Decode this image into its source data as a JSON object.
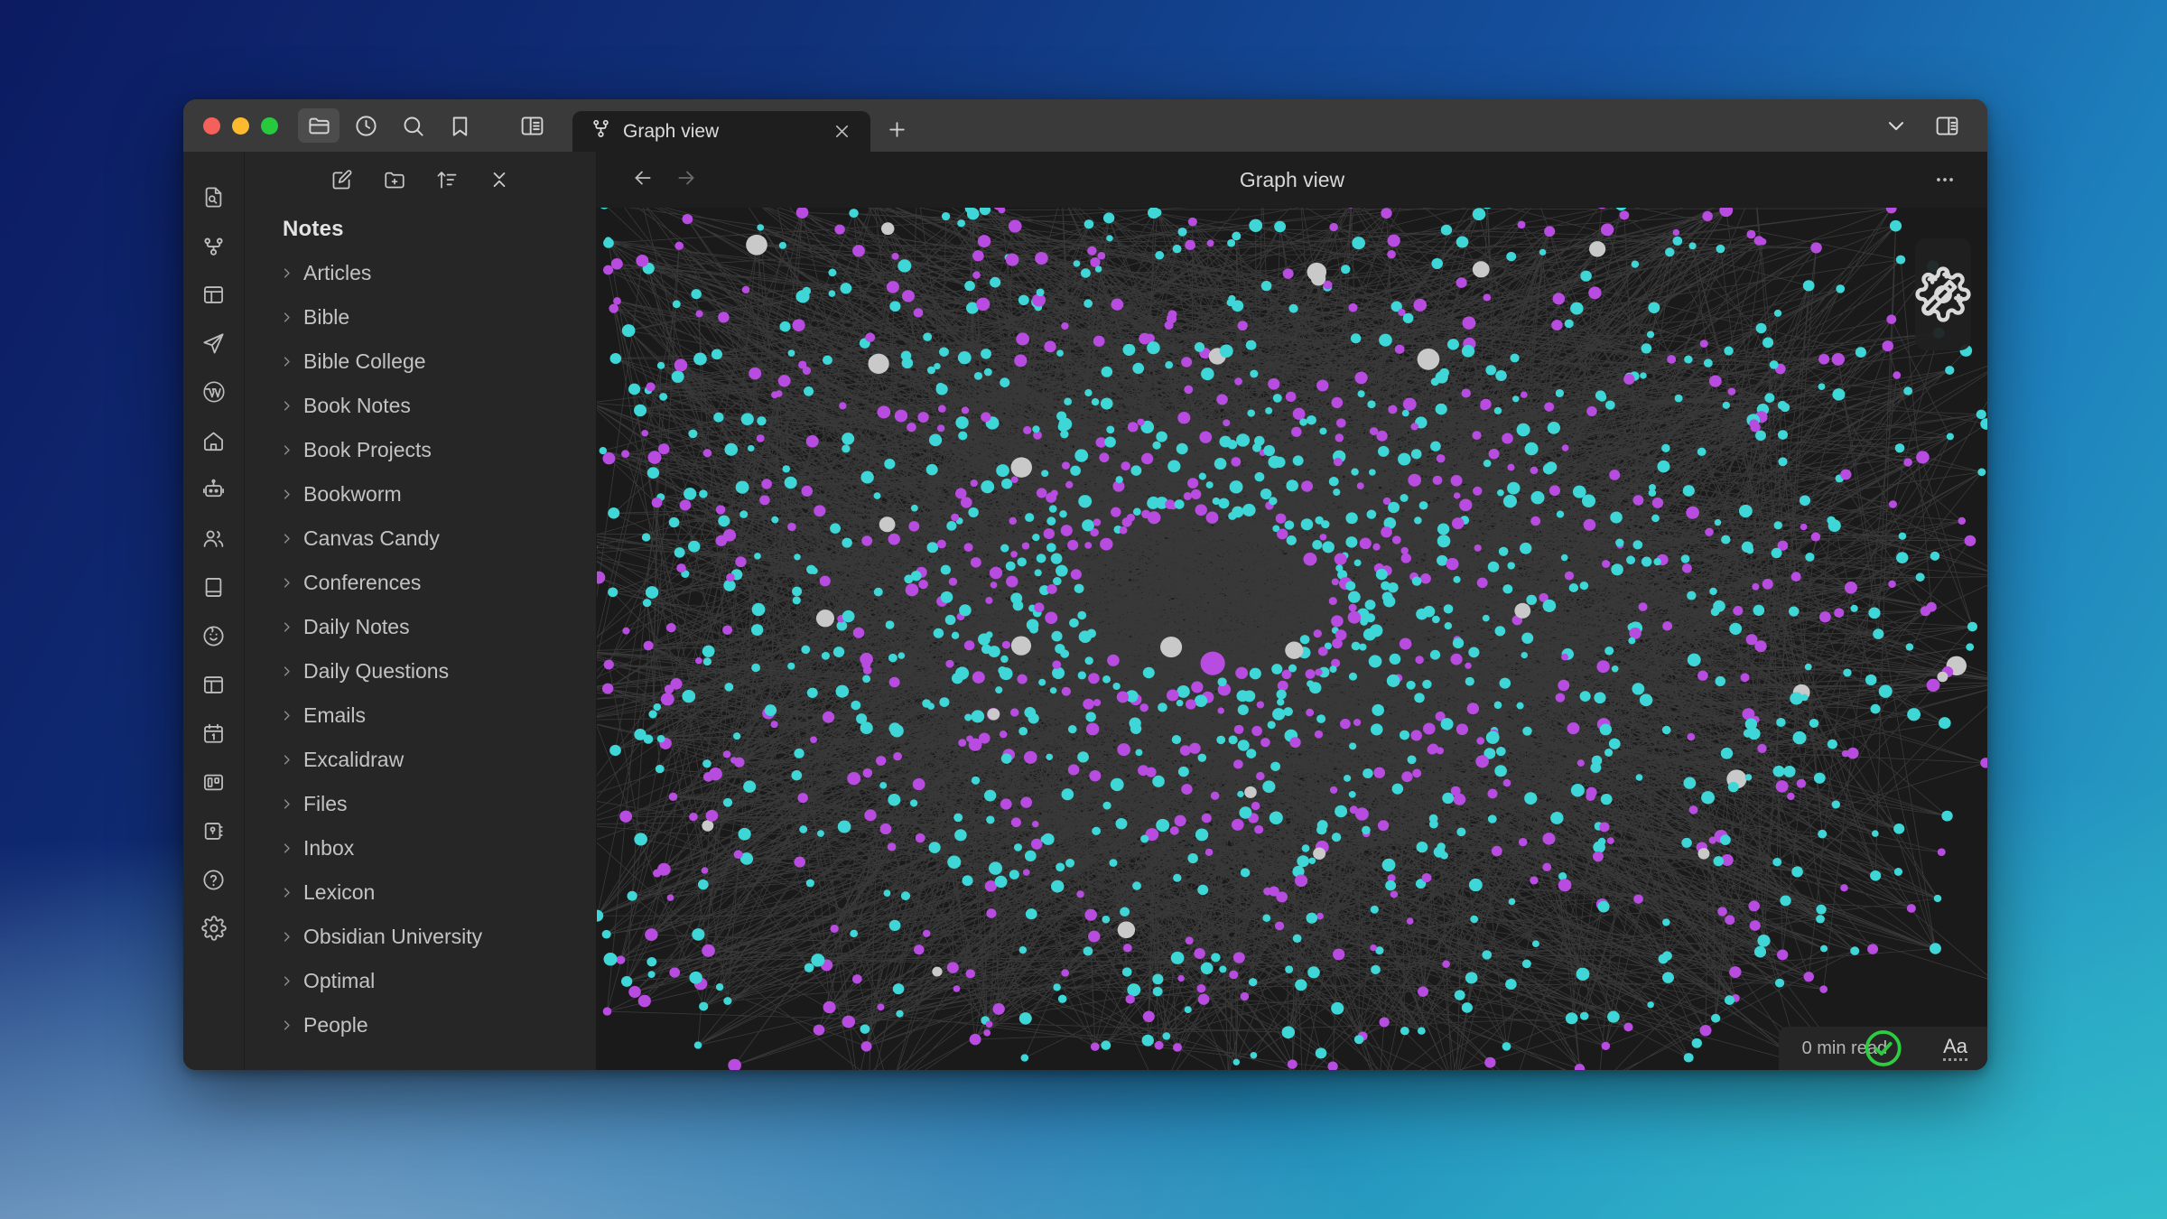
{
  "window": {
    "traffic_lights": [
      {
        "name": "close",
        "color": "#f5605a"
      },
      {
        "name": "minimize",
        "color": "#fcbb2e"
      },
      {
        "name": "maximize",
        "color": "#27c93f"
      }
    ],
    "titlebar_icons": [
      {
        "name": "files-icon",
        "label": "Files",
        "active": true
      },
      {
        "name": "recent-files-icon",
        "label": "Recent files",
        "active": false
      },
      {
        "name": "search-icon",
        "label": "Search",
        "active": false
      },
      {
        "name": "bookmarks-icon",
        "label": "Bookmarks",
        "active": false
      },
      {
        "name": "toggle-left-sidebar-icon",
        "label": "Toggle left sidebar",
        "active": false
      }
    ],
    "titlebar_right_icons": [
      {
        "name": "chevron-down-icon",
        "label": "Tab list"
      },
      {
        "name": "toggle-right-sidebar-icon",
        "label": "Toggle right sidebar"
      }
    ]
  },
  "tabs": [
    {
      "label": "Graph view",
      "icon": "graph-icon",
      "active": true,
      "close_label": "Close tab"
    }
  ],
  "newtab": {
    "label": "New tab",
    "icon": "plus-icon"
  },
  "ribbon": {
    "items": [
      {
        "name": "quick-search-note-icon",
        "label": "Quick search"
      },
      {
        "name": "graph-view-icon",
        "label": "Graph view"
      },
      {
        "name": "dashboard-layout-icon",
        "label": "Dashboard"
      },
      {
        "name": "send-paper-plane-icon",
        "label": "Send"
      },
      {
        "name": "wordpress-icon",
        "label": "WordPress"
      },
      {
        "name": "home-icon",
        "label": "Home"
      },
      {
        "name": "robot-icon",
        "label": "AI assistant"
      },
      {
        "name": "people-icon",
        "label": "People"
      },
      {
        "name": "book-icon",
        "label": "Book"
      },
      {
        "name": "baby-face-icon",
        "label": "Kids"
      },
      {
        "name": "panel-layout-icon",
        "label": "Panel layout"
      },
      {
        "name": "calendar-icon",
        "label": "Calendar"
      },
      {
        "name": "kanban-icon",
        "label": "Kanban"
      },
      {
        "name": "map-notebook-icon",
        "label": "Map"
      },
      {
        "name": "help-circle-icon",
        "label": "Help"
      },
      {
        "name": "settings-gear-icon",
        "label": "Settings"
      }
    ]
  },
  "explorer": {
    "toolbar": [
      {
        "name": "new-note-icon",
        "label": "New note"
      },
      {
        "name": "new-folder-icon",
        "label": "New folder"
      },
      {
        "name": "sort-order-icon",
        "label": "Change sort order"
      },
      {
        "name": "collapse-all-icon",
        "label": "Collapse all"
      }
    ],
    "vault_title": "Notes",
    "folders": [
      {
        "label": "Articles",
        "expanded": false
      },
      {
        "label": "Bible",
        "expanded": false
      },
      {
        "label": "Bible College",
        "expanded": false
      },
      {
        "label": "Book Notes",
        "expanded": false
      },
      {
        "label": "Book Projects",
        "expanded": false
      },
      {
        "label": "Bookworm",
        "expanded": false
      },
      {
        "label": "Canvas Candy",
        "expanded": false
      },
      {
        "label": "Conferences",
        "expanded": false
      },
      {
        "label": "Daily Notes",
        "expanded": false
      },
      {
        "label": "Daily Questions",
        "expanded": false
      },
      {
        "label": "Emails",
        "expanded": false
      },
      {
        "label": "Excalidraw",
        "expanded": false
      },
      {
        "label": "Files",
        "expanded": false
      },
      {
        "label": "Inbox",
        "expanded": false
      },
      {
        "label": "Lexicon",
        "expanded": false
      },
      {
        "label": "Obsidian University",
        "expanded": false
      },
      {
        "label": "Optimal",
        "expanded": false
      },
      {
        "label": "People",
        "expanded": false
      }
    ]
  },
  "main": {
    "back_label": "Navigate back",
    "forward_label": "Navigate forward",
    "view_title": "Graph view",
    "more_options_label": "More options"
  },
  "graph": {
    "controls": [
      {
        "name": "graph-settings-gear-icon",
        "label": "Open graph settings"
      },
      {
        "name": "restore-default-wand-icon",
        "label": "Restore default settings"
      }
    ],
    "colors": {
      "background": "#1a1a1a",
      "edge": "#555555",
      "node_cyan": "#3ed6d6",
      "node_purple": "#b84ce0",
      "node_neutral": "#c9c9c9"
    }
  },
  "statusbar": {
    "read_time": "0 min read",
    "check_label": "Vault synced",
    "font_label": "Aa",
    "check_color": "#2ecc40"
  }
}
